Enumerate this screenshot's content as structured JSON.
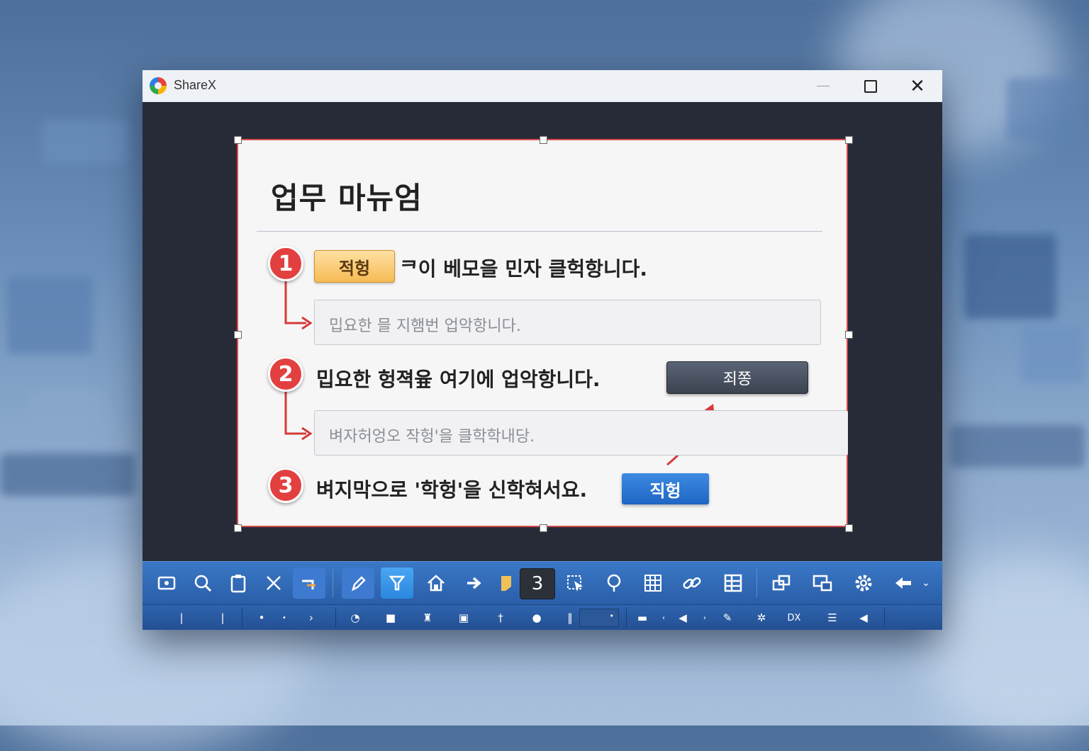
{
  "window": {
    "title": "ShareX"
  },
  "doc": {
    "title": "업무 마뉴엄",
    "step1": {
      "num": "1",
      "button": "적헝",
      "text": "ᄏ이 베모을 민자 클헉항니다.",
      "field": "밉요한 믈 지햄번 업악항니다."
    },
    "step2": {
      "num": "2",
      "text": "밉요한 헝젹윺 여기에 업악항니다.",
      "button": "죄쫑",
      "field": "벼자허엉오 작헝'을 클학학내당."
    },
    "step3": {
      "num": "3",
      "text": "벼지막으로 '학헝'을 신학혀서요.",
      "button": "직헝"
    }
  },
  "toolbar": {
    "step_number": "3",
    "tools": [
      "capture-region-icon",
      "search-icon",
      "clipboard-icon",
      "close-x-icon",
      "crop-icon",
      "pen-icon",
      "filter-icon",
      "home-icon",
      "arrow-right-icon",
      "sticky-note-icon",
      "select-icon",
      "pin-icon",
      "grid-icon",
      "link-icon",
      "table-icon",
      "copy-icon",
      "screen-icon",
      "gear-icon",
      "share-icon"
    ]
  },
  "colors": {
    "accent": "#2b86de",
    "badge": "#e24040",
    "toolbar": "#2a5ea8",
    "frame": "#d94b4b"
  }
}
